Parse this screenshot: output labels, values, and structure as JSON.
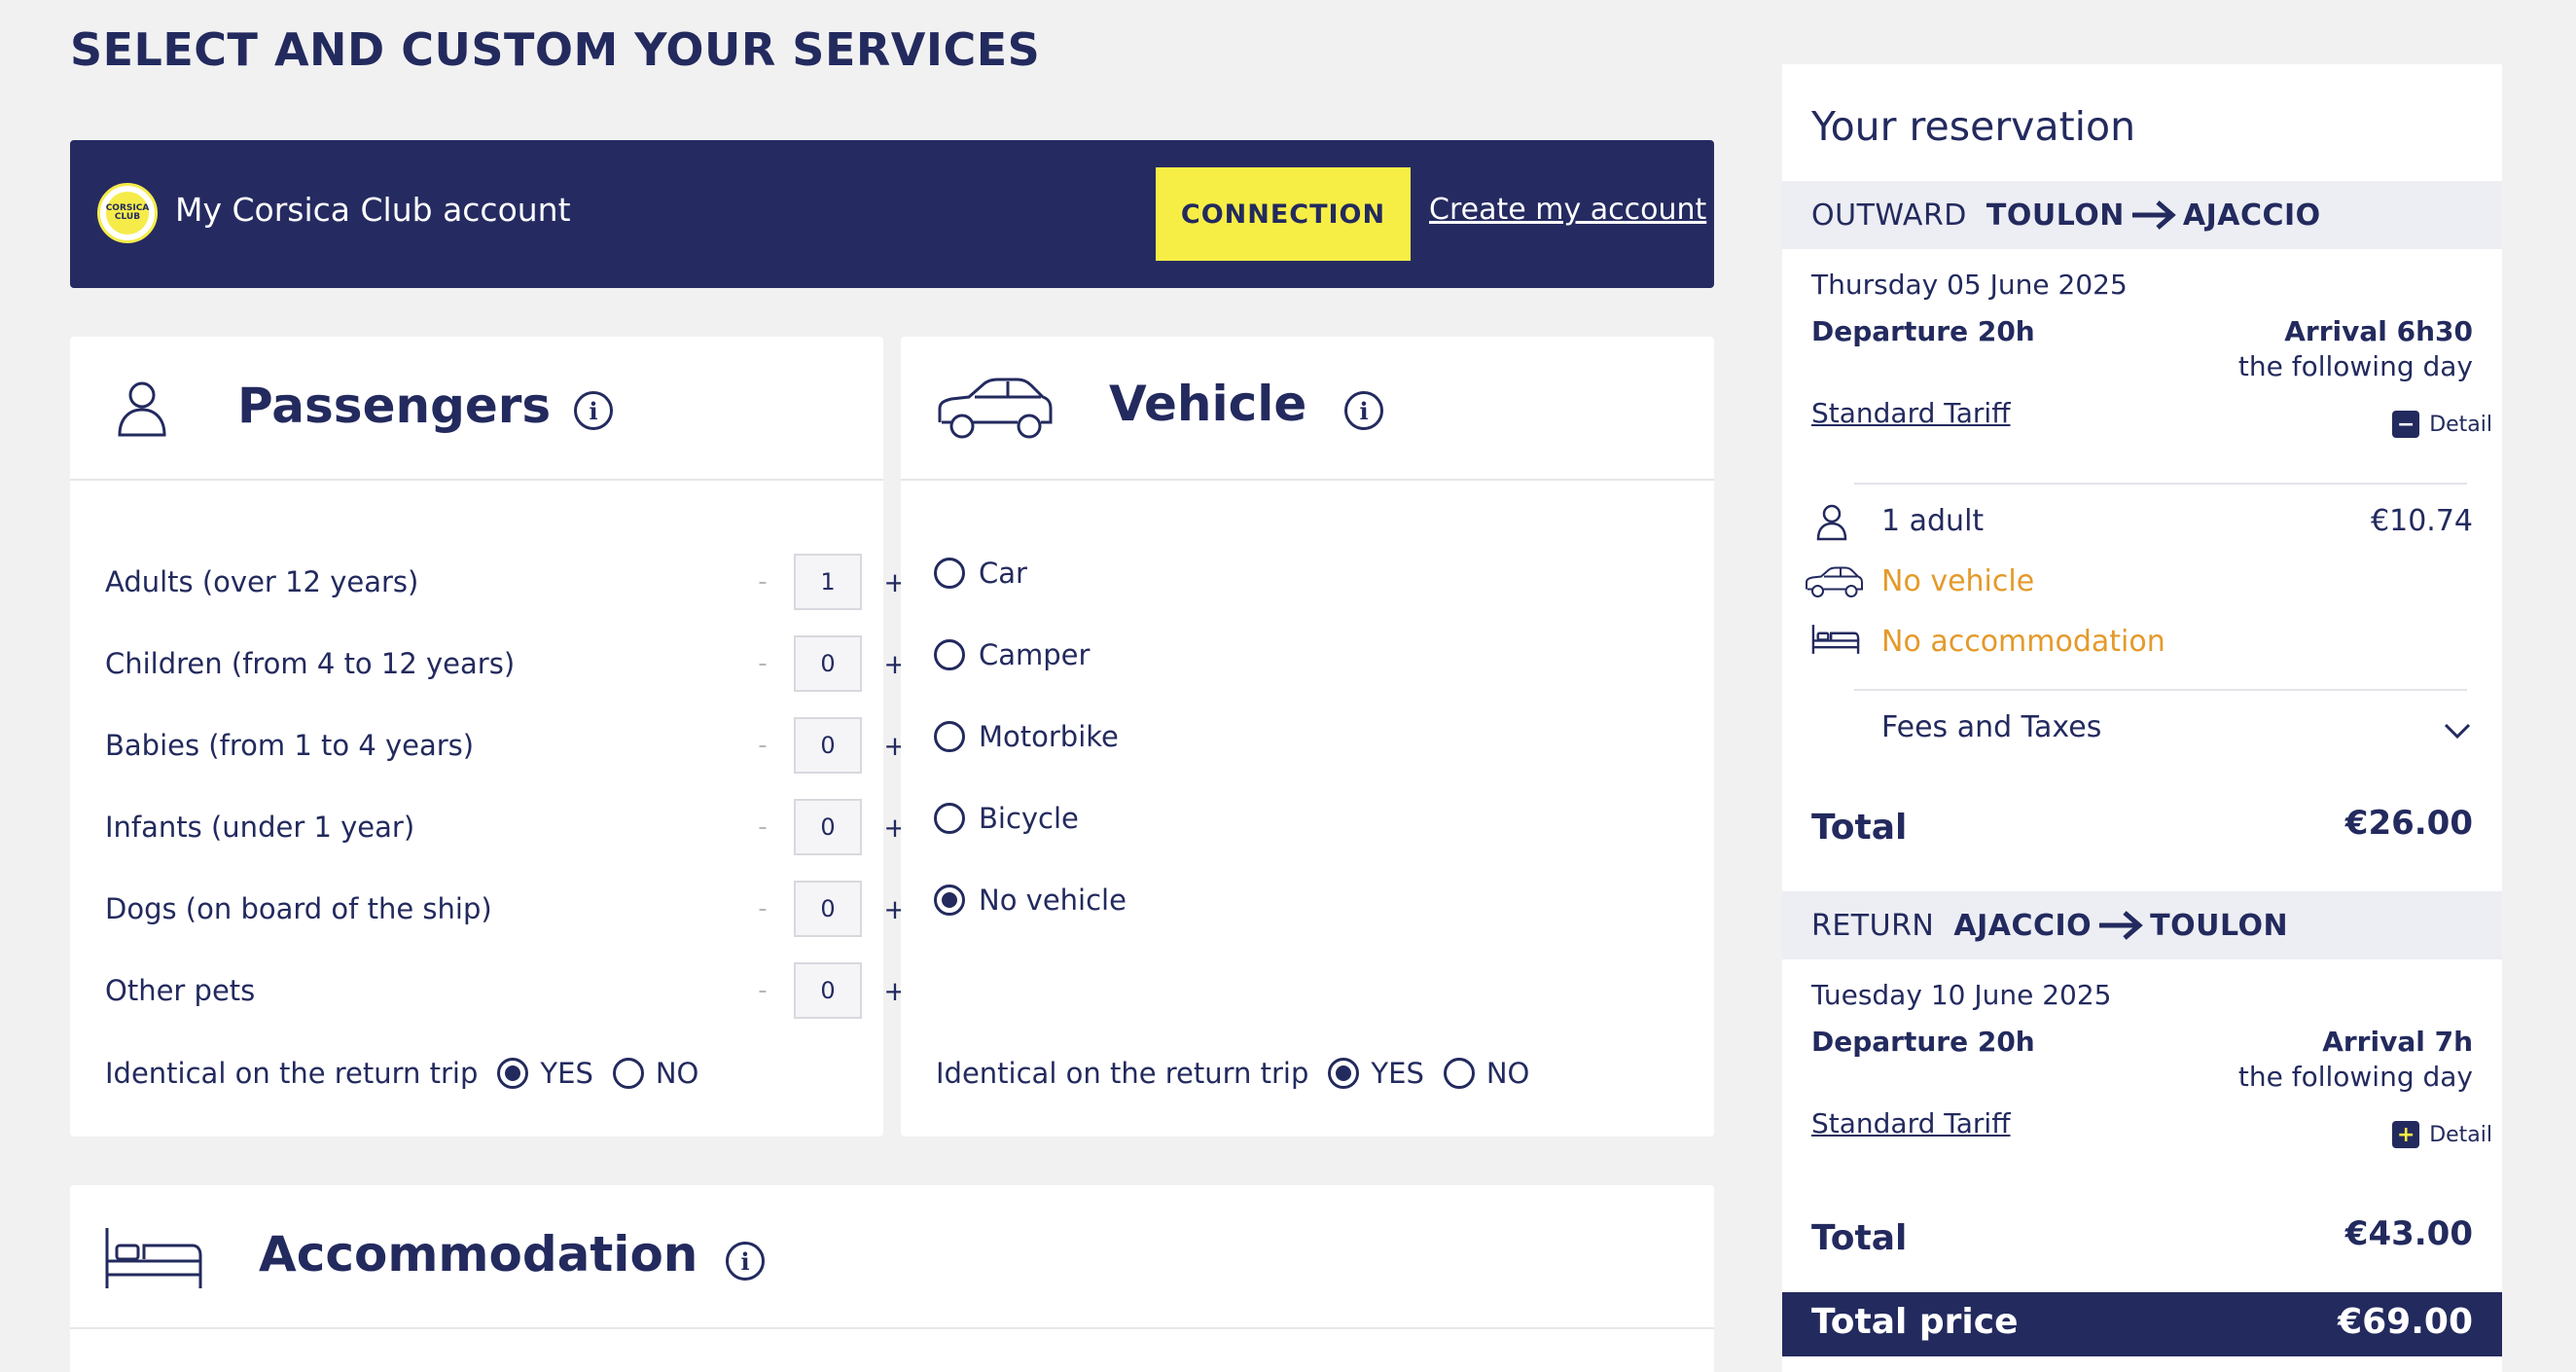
{
  "page": {
    "title": "SELECT AND CUSTOM YOUR SERVICES"
  },
  "club": {
    "logo_text": "CORSICA CLUB",
    "label": "My Corsica Club account",
    "connect_label": "CONNECTION",
    "create_label": "Create my account"
  },
  "passengers": {
    "title": "Passengers",
    "rows": [
      {
        "label": "Adults (over 12 years)",
        "value": "1"
      },
      {
        "label": "Children (from 4 to 12 years)",
        "value": "0"
      },
      {
        "label": "Babies (from 1 to 4 years)",
        "value": "0"
      },
      {
        "label": "Infants (under 1 year)",
        "value": "0"
      },
      {
        "label": "Dogs (on board of the ship)",
        "value": "0"
      },
      {
        "label": "Other pets",
        "value": "0"
      }
    ],
    "minus": "-",
    "plus": "+",
    "identical_label": "Identical on the return trip",
    "yes": "YES",
    "no": "NO"
  },
  "vehicle": {
    "title": "Vehicle",
    "options": [
      "Car",
      "Camper",
      "Motorbike",
      "Bicycle",
      "No vehicle"
    ],
    "selected": "No vehicle",
    "identical_label": "Identical on the return trip",
    "yes": "YES",
    "no": "NO"
  },
  "accommodation": {
    "title": "Accommodation"
  },
  "reservation": {
    "title": "Your reservation",
    "outward": {
      "kw": "OUTWARD",
      "from": "TOULON",
      "to": "AJACCIO",
      "date": "Thursday 05 June 2025",
      "departure": "Departure 20h",
      "arrival": "Arrival 6h30",
      "following": "the following day",
      "tariff": "Standard Tariff",
      "detail": "Detail",
      "adults": "1 adult",
      "adults_price": "€10.74",
      "vehicle": "No vehicle",
      "accommodation": "No accommodation",
      "fees": "Fees and Taxes",
      "total_label": "Total",
      "total": "€26.00"
    },
    "return": {
      "kw": "RETURN",
      "from": "AJACCIO",
      "to": "TOULON",
      "date": "Tuesday 10 June 2025",
      "departure": "Departure 20h",
      "arrival": "Arrival 7h",
      "following": "the following day",
      "tariff": "Standard Tariff",
      "detail": "Detail",
      "total_label": "Total",
      "total": "€43.00"
    },
    "total_price_label": "Total price",
    "total_price": "€69.00"
  }
}
